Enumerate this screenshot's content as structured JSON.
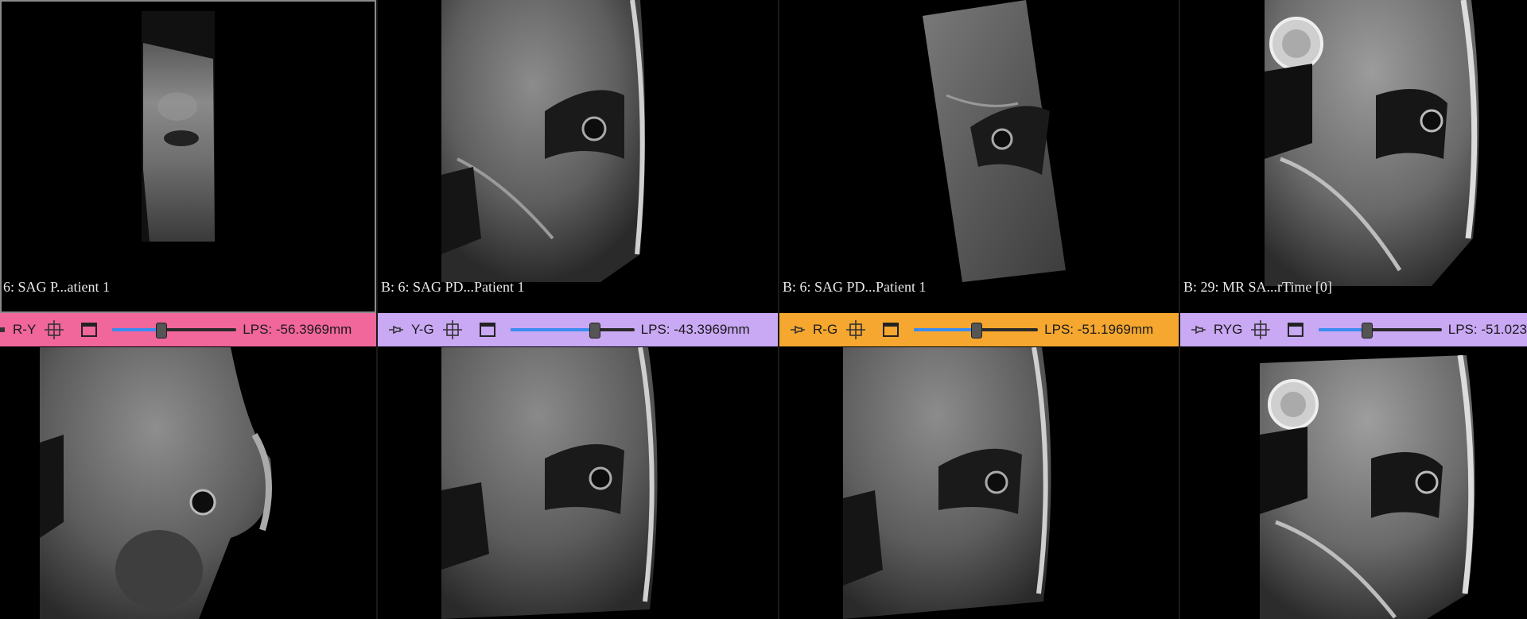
{
  "viewports": {
    "top": [
      {
        "label": "6: SAG P...atient 1"
      },
      {
        "label": "B: 6: SAG PD...Patient 1"
      },
      {
        "label": "B: 6: SAG PD...Patient 1"
      },
      {
        "label": "B: 29: MR SA...rTime [0]"
      }
    ]
  },
  "toolbars": [
    {
      "layer": "R-Y",
      "lps": "LPS: -56.3969mm",
      "slider_pct": 0.38,
      "color": "#f1669b"
    },
    {
      "layer": "Y-G",
      "lps": "LPS: -43.3969mm",
      "slider_pct": 0.69,
      "color": "#c9a8f4"
    },
    {
      "layer": "R-G",
      "lps": "LPS: -51.1969mm",
      "slider_pct": 0.5,
      "color": "#f5a72f"
    },
    {
      "layer": "RYG",
      "lps": "LPS: -51.023",
      "slider_pct": 0.38,
      "color": "#c9a8f4"
    }
  ],
  "icons": {
    "pin": "pin-icon",
    "crosshair": "crosshair-icon",
    "window": "window-icon"
  }
}
